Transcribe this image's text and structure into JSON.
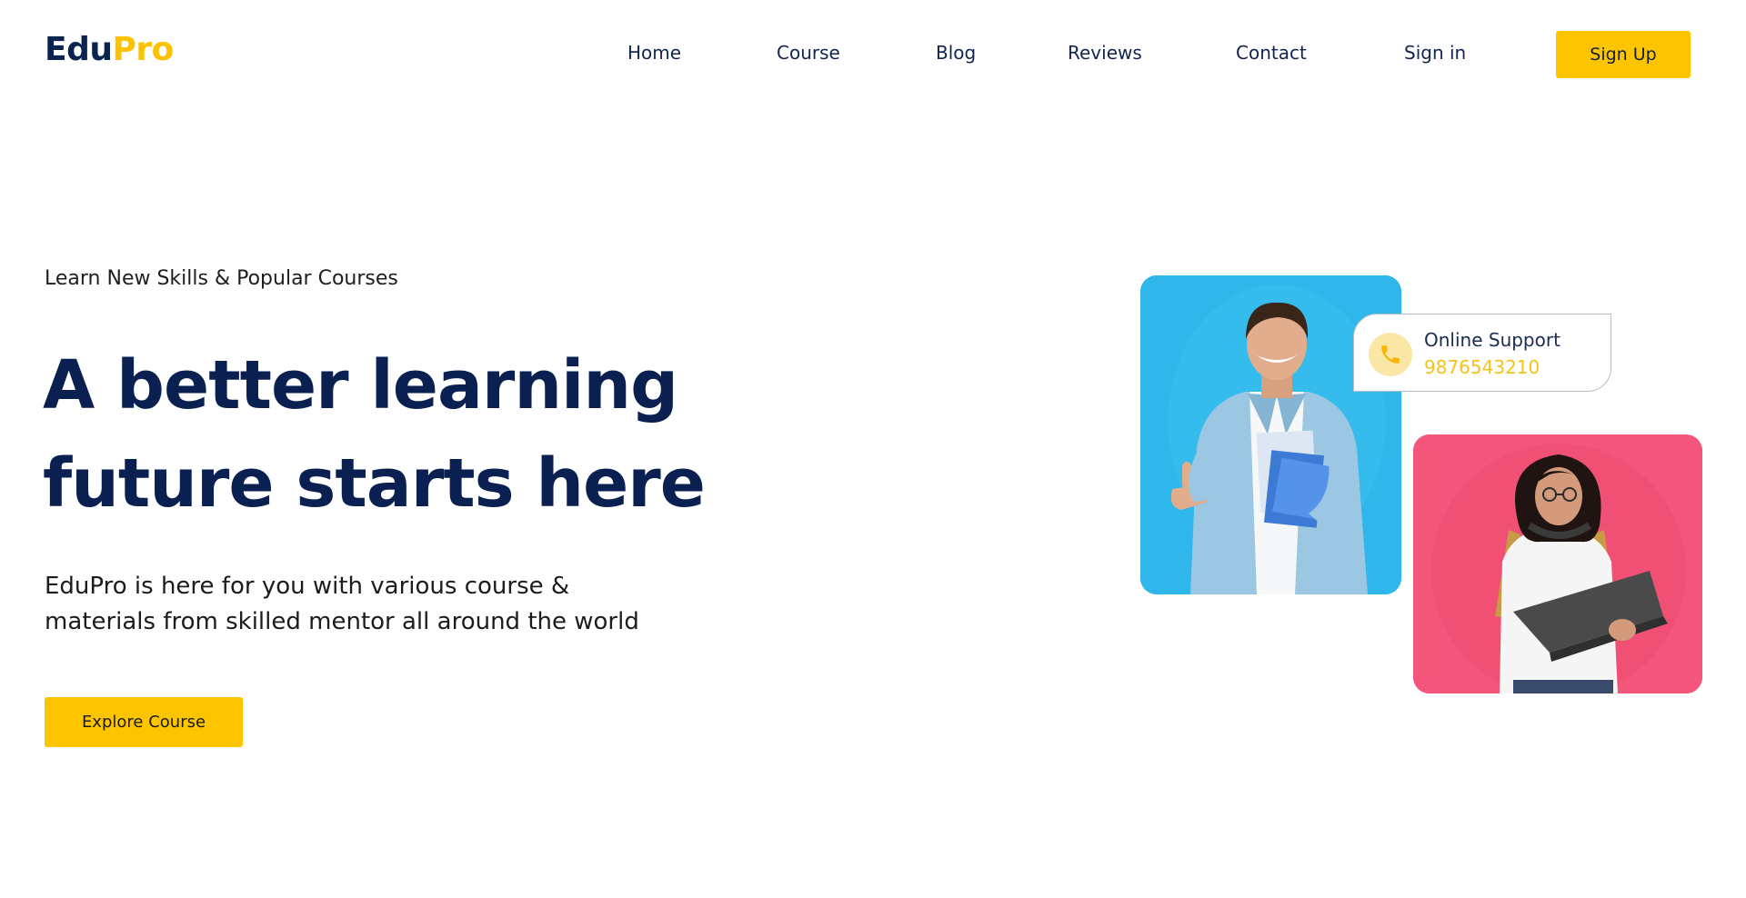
{
  "brand": {
    "part1": "Edu",
    "part2": "Pro"
  },
  "nav": {
    "items": [
      "Home",
      "Course",
      "Blog",
      "Reviews",
      "Contact",
      "Sign in"
    ],
    "signup_label": "Sign Up"
  },
  "hero": {
    "eyebrow": "Learn New Skills & Popular Courses",
    "headline_line1": "A better learning",
    "headline_line2": "future starts here",
    "description_line1": "EduPro is here for you with various course &",
    "description_line2": "materials from skilled mentor all around the world",
    "cta_label": "Explore Course"
  },
  "support_card": {
    "title": "Online Support",
    "phone": "9876543210",
    "icon": "phone-icon"
  },
  "colors": {
    "accent": "#fcc500",
    "navy": "#0a2050",
    "photo_blue": "#2fb6ea",
    "photo_pink": "#f3567a"
  }
}
